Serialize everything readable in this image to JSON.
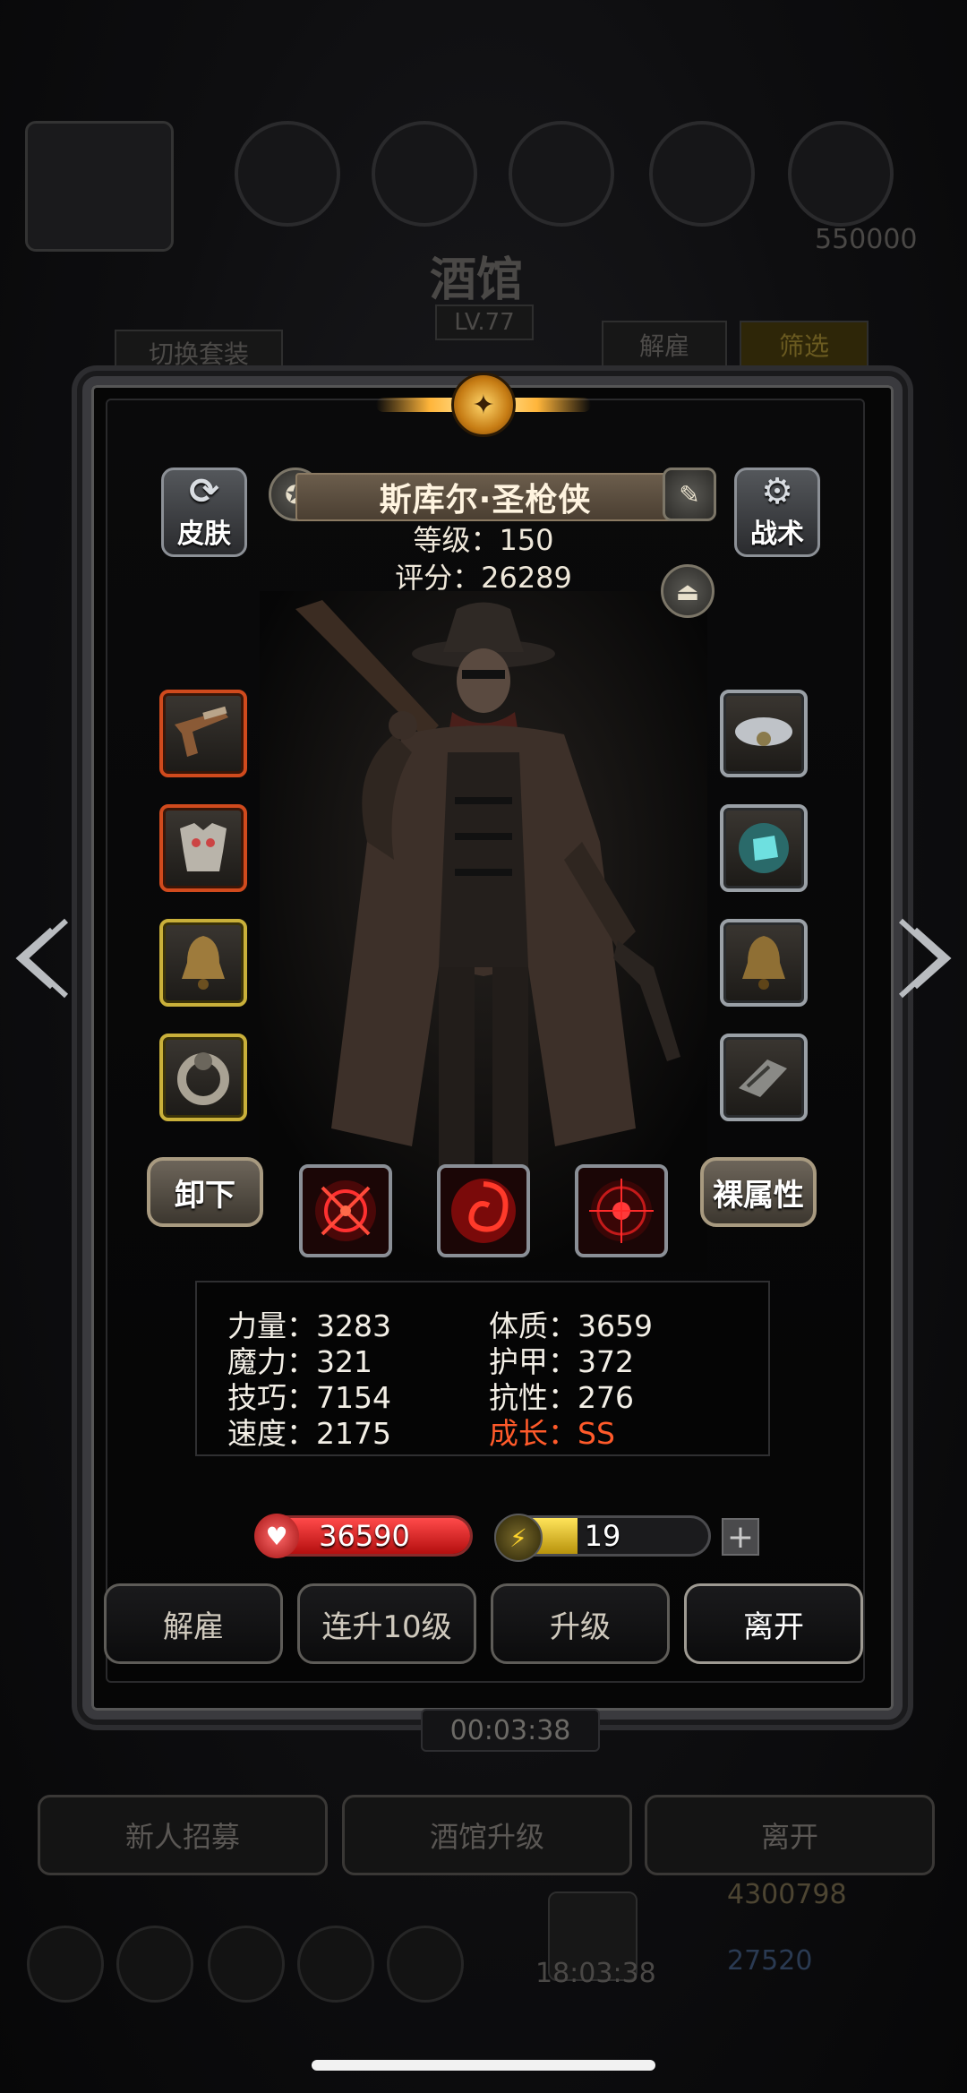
{
  "background": {
    "title": "酒馆",
    "level": "LV.77",
    "switch_outfit": "切换套装",
    "dismiss": "解雇",
    "filter": "筛选",
    "gold_partial": "550000",
    "timer": "00:03:38",
    "recruit": "新人招募",
    "tavern_upgrade": "酒馆升级",
    "leave": "离开",
    "chest_timer": "18:03:38",
    "gold": "4300798",
    "gems": "27520"
  },
  "hero": {
    "name": "斯库尔·圣枪侠",
    "level_text": "等级：150",
    "score_text": "评分：26289"
  },
  "buttons": {
    "skin": "皮肤",
    "tactics": "战术",
    "unequip": "卸下",
    "bare_stats": "裸属性"
  },
  "equipment": {
    "left": [
      "flintlock-pistol",
      "chest-armor",
      "bronze-bell",
      "ornate-ring"
    ],
    "right": [
      "storm-amulet",
      "cyan-gem",
      "bronze-bell",
      "engraved-bracer"
    ]
  },
  "skills": [
    "crosshair-skill",
    "vortex-skill",
    "target-skill"
  ],
  "stats": {
    "strength": "力量：3283",
    "constitution": "体质：3659",
    "magic": "魔力：321",
    "armor": "护甲：372",
    "skill": "技巧：7154",
    "resistance": "抗性：276",
    "speed": "速度：2175",
    "growth": "成长：SS"
  },
  "bars": {
    "hp": "36590",
    "hp_fill": 1.0,
    "energy": "19",
    "energy_fill": 0.38
  },
  "actions": {
    "dismiss": "解雇",
    "upgrade10": "连升10级",
    "upgrade": "升级",
    "leave": "离开"
  },
  "colors": {
    "accent_gold": "#c9b03a",
    "accent_red": "#d04a1d",
    "growth_red": "#ff5a2a",
    "hp_red": "#d81f1f",
    "energy_yellow": "#e8c21c"
  }
}
